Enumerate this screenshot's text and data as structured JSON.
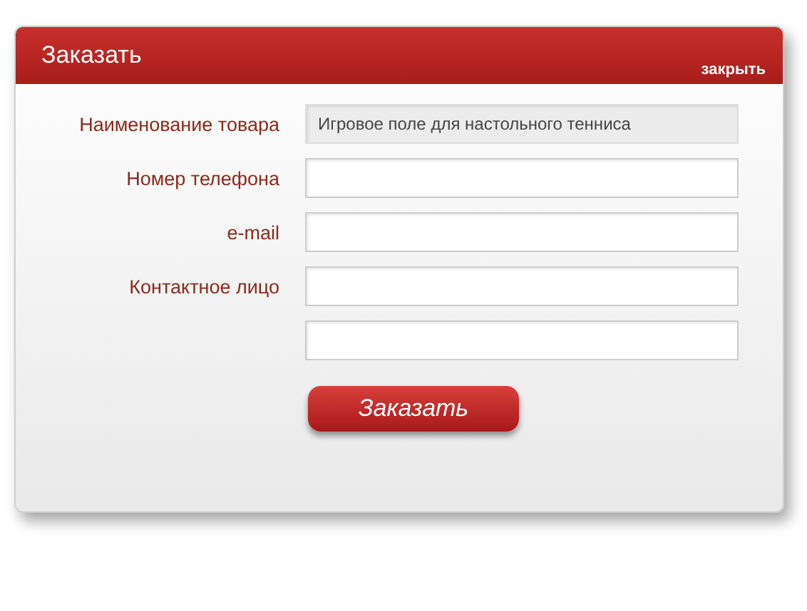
{
  "dialog": {
    "title": "Заказать",
    "close": "закрыть"
  },
  "fields": [
    {
      "label": "Наименование товара",
      "value": "Игровое поле для настольного тенниса",
      "disabled": true
    },
    {
      "label": "Номер телефона",
      "disabled": false
    },
    {
      "label": "e-mail",
      "disabled": false
    },
    {
      "label": "Контактное лицо",
      "disabled": false
    },
    {
      "disabled": false
    }
  ],
  "submit": "Заказать"
}
